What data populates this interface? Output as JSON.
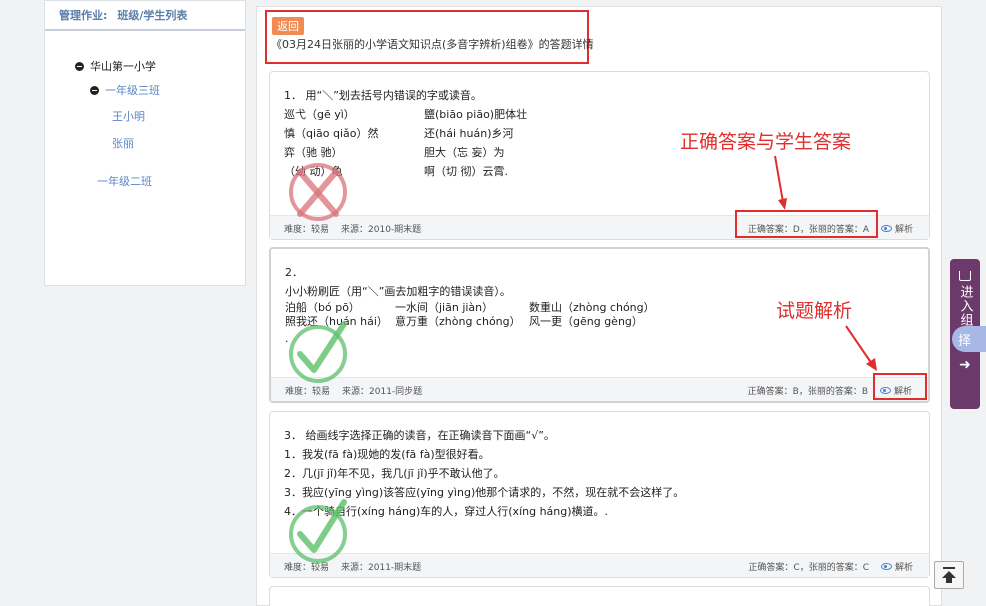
{
  "sidebar": {
    "head_label": "管理作业:",
    "head_link": "班级/学生列表",
    "tree": {
      "school": "华山第一小学",
      "class_a": "一年级三班",
      "student_1": "王小明",
      "student_2": "张丽",
      "class_b": "一年级二班"
    }
  },
  "header": {
    "back_label": "返回",
    "title": "《03月24日张丽的小学语文知识点(多音字辨析)组卷》的答题详情"
  },
  "questions": [
    {
      "lines": [
        [
          "1．  用“＼”划去括号内错误的字或读音。"
        ],
        [
          "巡弋（gē    yì）",
          "鹽(biāo  piāo)肥体壮"
        ],
        [
          "慎（qiāo  qiǎo）然",
          "还(hái  huán)乡河"
        ],
        [
          "弈（驰    驰）",
          "胆大（忘  妄）为"
        ],
        [
          "（幼    动）龟",
          "啊（切  彻）云霄."
        ]
      ],
      "difficulty": "难度：较易",
      "source": "来源：2010-期末题",
      "answer": "正确答案：D，张丽的答案：A",
      "analysis": "解析",
      "result": "wrong"
    },
    {
      "lines": [
        [
          "2．"
        ],
        [
          "小小粉刷匠（用“＼”画去加粗字的错误读音）。"
        ],
        [
          "泊船（bó  pō）",
          "一水间（jiān  jiàn）",
          "数重山（zhòng  chóng）"
        ],
        [
          "照我还（huán  hái）",
          "意万重（zhòng  chóng）",
          "风一更（gēng  gèng）"
        ],
        [
          "."
        ]
      ],
      "difficulty": "难度：较易",
      "source": "来源：2011-同步题",
      "answer": "正确答案：B，张丽的答案：B",
      "analysis": "解析",
      "result": "right"
    },
    {
      "lines": [
        [
          "3．  给画线字选择正确的读音，在正确读音下面画“√”。"
        ],
        [
          "1．我发(fā fà)现她的发(fā fà)型很好看。"
        ],
        [
          "2．几(jī    jǐ)年不见，我几(jī jǐ)乎不敢认他了。"
        ],
        [
          "3．我应(yīng  yìng)该答应(yīng  yìng)他那个请求的，不然，现在就不会这样了。"
        ],
        [
          "4．一个骑自行(xíng  háng)车的人，穿过人行(xíng háng)横道。."
        ]
      ],
      "difficulty": "难度：较易",
      "source": "来源：2011-期末题",
      "answer": "正确答案：C，张丽的答案：C",
      "analysis": "解析",
      "result": "right"
    }
  ],
  "annotations": {
    "answer_label": "正确答案与学生答案",
    "analysis_label": "试题解析"
  },
  "side": {
    "tab_text": "进入组",
    "bubble": "择",
    "arrow": "➜"
  },
  "colors": {
    "annotation_red": "#e02d2d",
    "back_orange": "#f08b53",
    "link_blue": "#5a86c6",
    "wrong_mark": "#d9737a",
    "right_mark": "#5cbf6a",
    "side_tab": "#6b3a6b"
  }
}
